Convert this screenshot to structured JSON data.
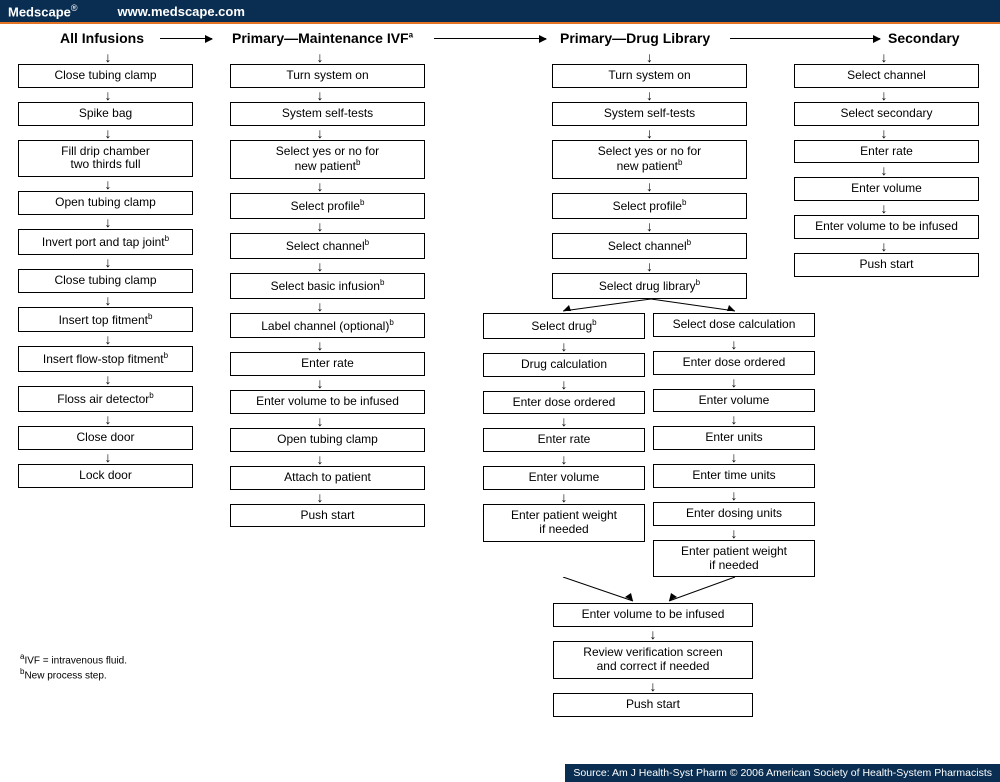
{
  "header": {
    "brand": "Medscape",
    "reg": "®",
    "url": "www.medscape.com"
  },
  "titles": {
    "a": "All Infusions",
    "b": "Primary—Maintenance IVF",
    "b_sup": "a",
    "c": "Primary—Drug Library",
    "d": "Secondary"
  },
  "col_a": [
    "Close tubing clamp",
    "Spike bag",
    "Fill drip chamber\ntwo thirds full",
    "Open tubing clamp",
    "Invert port and tap joint",
    "Close tubing clamp",
    "Insert top fitment",
    "Insert flow-stop fitment",
    "Floss air detector",
    "Close door",
    "Lock door"
  ],
  "col_a_sup": [
    "",
    "",
    "",
    "",
    "b",
    "",
    "b",
    "b",
    "b",
    "",
    ""
  ],
  "col_b": [
    "Turn system on",
    "System self-tests",
    "Select yes or no for\nnew patient",
    "Select profile",
    "Select channel",
    "Select basic infusion",
    "Label channel (optional)",
    "Enter rate",
    "Enter volume to be infused",
    "Open tubing clamp",
    "Attach to patient",
    "Push start"
  ],
  "col_b_sup": [
    "",
    "",
    "b",
    "b",
    "b",
    "b",
    "b",
    "",
    "",
    "",
    "",
    ""
  ],
  "col_c_top": [
    "Turn system on",
    "System self-tests",
    "Select yes or no for\nnew patient",
    "Select profile",
    "Select channel",
    "Select drug library"
  ],
  "col_c_top_sup": [
    "",
    "",
    "b",
    "b",
    "b",
    "b"
  ],
  "col_c_left": [
    "Select drug",
    "Drug calculation",
    "Enter dose ordered",
    "Enter rate",
    "Enter volume",
    "Enter patient weight\nif needed"
  ],
  "col_c_left_sup": [
    "b",
    "",
    "",
    "",
    "",
    ""
  ],
  "col_c_right": [
    "Select dose calculation",
    "Enter dose ordered",
    "Enter volume",
    "Enter units",
    "Enter time units",
    "Enter dosing units",
    "Enter patient weight\nif needed"
  ],
  "col_c_merge": [
    "Enter volume to be infused",
    "Review verification screen\nand correct if needed",
    "Push start"
  ],
  "col_d": [
    "Select channel",
    "Select secondary",
    "Enter rate",
    "Enter volume",
    "Enter volume to be infused",
    "Push start"
  ],
  "footnotes": {
    "a": "IVF = intravenous fluid.",
    "b": "New process step."
  },
  "credit": "Source: Am J Health-Syst Pharm © 2006 American Society of Health-System Pharmacists"
}
